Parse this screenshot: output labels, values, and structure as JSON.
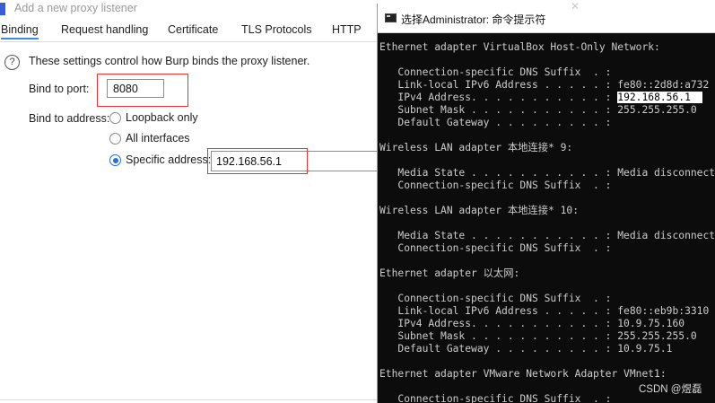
{
  "burp": {
    "title": "Add a new proxy listener",
    "tabs": [
      {
        "label": "Binding"
      },
      {
        "label": "Request handling"
      },
      {
        "label": "Certificate"
      },
      {
        "label": "TLS Protocols"
      },
      {
        "label": "HTTP"
      }
    ],
    "active_tab": "Binding",
    "help_glyph": "?",
    "intro": "These settings control how Burp binds the proxy listener.",
    "bind_port_label": "Bind to port:",
    "bind_port_value": "8080",
    "bind_address_label": "Bind to address:",
    "options": {
      "loopback": "Loopback only",
      "all": "All interfaces",
      "specific": "Specific address:"
    },
    "selected_option": "specific",
    "specific_address_value": "192.168.56.1",
    "highlight_color": "#d9393a"
  },
  "cmd": {
    "title": "选择Administrator: 命令提示符",
    "lines": [
      "Ethernet adapter VirtualBox Host-Only Network:",
      "",
      "   Connection-specific DNS Suffix  . :",
      "   Link-local IPv6 Address . . . . . : fe80::2d8d:a732",
      "   IPv4 Address. . . . . . . . . . . : 192.168.56.1",
      "   Subnet Mask . . . . . . . . . . . : 255.255.255.0",
      "   Default Gateway . . . . . . . . . :",
      "",
      "Wireless LAN adapter 本地连接* 9:",
      "",
      "   Media State . . . . . . . . . . . : Media disconnect",
      "   Connection-specific DNS Suffix  . :",
      "",
      "Wireless LAN adapter 本地连接* 10:",
      "",
      "   Media State . . . . . . . . . . . : Media disconnect",
      "   Connection-specific DNS Suffix  . :",
      "",
      "Ethernet adapter 以太网:",
      "",
      "   Connection-specific DNS Suffix  . :",
      "   Link-local IPv6 Address . . . . . : fe80::eb9b:3310",
      "   IPv4 Address. . . . . . . . . . . : 10.9.75.160",
      "   Subnet Mask . . . . . . . . . . . : 255.255.255.0",
      "   Default Gateway . . . . . . . . . : 10.9.75.1",
      "",
      "Ethernet adapter VMware Network Adapter VMnet1:",
      "",
      "   Connection-specific DNS Suffix  . :"
    ],
    "selected_line_index": 4,
    "selected_text": "192.168.56.1"
  },
  "watermark": "CSDN @煜磊"
}
